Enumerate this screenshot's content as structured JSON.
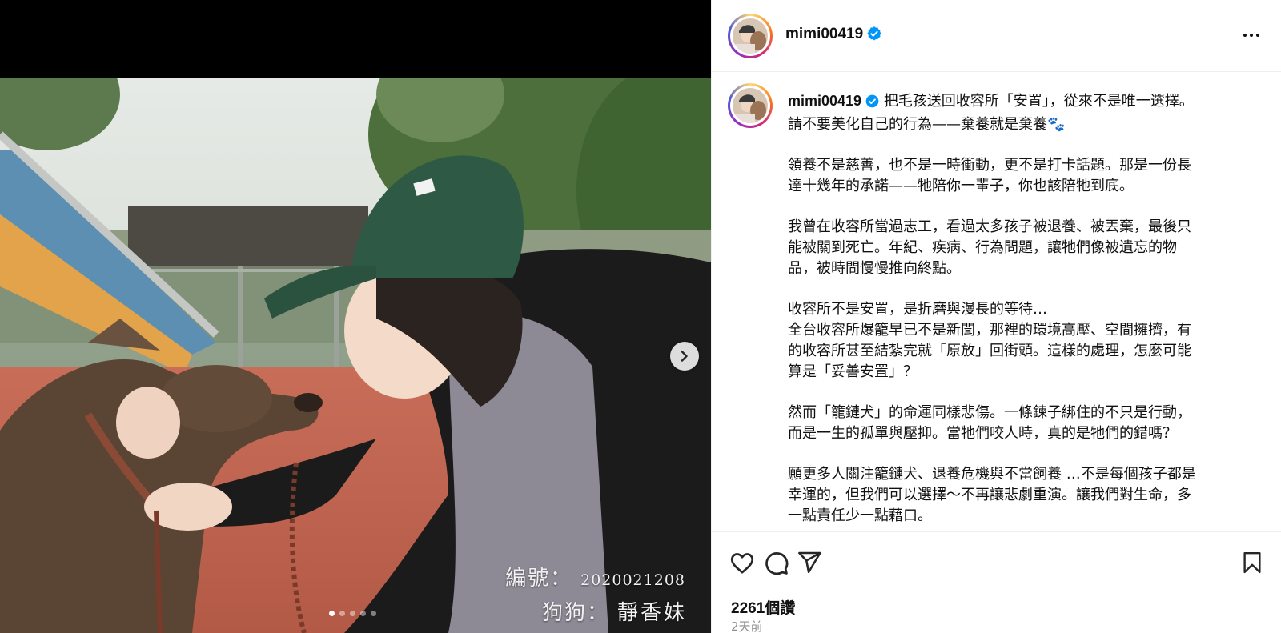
{
  "post": {
    "username": "mimi00419",
    "verified": true,
    "caption_lead": "把毛孩送回收容所「安置」，從來不是唯一選擇。",
    "paragraphs": [
      [
        "請不要美化自己的行為——棄養就是棄養🐾"
      ],
      [
        "領養不是慈善，也不是一時衝動，更不是打卡話題。那是一份長",
        "達十幾年的承諾——牠陪你一輩子，你也該陪牠到底。"
      ],
      [
        "我曾在收容所當過志工，看過太多孩子被退養、被丟棄，最後只",
        "能被關到死亡。年紀、疾病、行為問題，讓牠們像被遺忘的物",
        "品，被時間慢慢推向終點。"
      ],
      [
        "收容所不是安置，是折磨與漫長的等待…",
        "全台收容所爆籠早已不是新聞，那裡的環境高壓、空間擁擠，有",
        "的收容所甚至結紮完就「原放」回街頭。這樣的處理，怎麼可能",
        "算是「妥善安置」？"
      ],
      [
        "然而「籠鏈犬」的命運同樣悲傷。一條鍊子綁住的不只是行動，",
        "而是一生的孤單與壓抑。當牠們咬人時，真的是牠們的錯嗎？"
      ],
      [
        "願更多人關注籠鏈犬、退養危機與不當飼養 …不是每個孩子都是",
        "幸運的，但我們可以選擇～不再讓悲劇重演。讓我們對生命，多",
        "一點責任少一點藉口。"
      ]
    ],
    "likes": "2261個讚",
    "time": "2天前"
  },
  "media": {
    "caption_number_key": "編號：",
    "caption_number_value": "2020021208",
    "caption_name_key": "狗狗：",
    "caption_name_value": "靜香妹",
    "slide_count": 5,
    "active_slide": 1
  },
  "icons": {
    "verified": "verified-badge-icon",
    "more": "more-options-icon",
    "like": "heart-icon",
    "comment": "comment-bubble-icon",
    "share": "paper-plane-icon",
    "save": "bookmark-icon",
    "next": "chevron-right-icon"
  },
  "colors": {
    "verified_blue": "#0095f6",
    "muted_text": "#8e8e8e",
    "divider": "#efefef"
  }
}
